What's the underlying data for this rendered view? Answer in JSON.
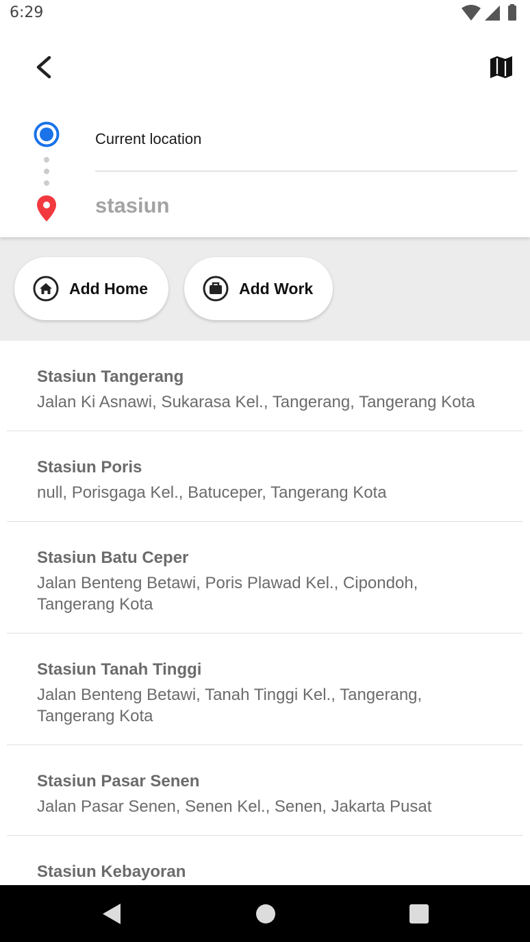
{
  "status_bar": {
    "time": "6:29"
  },
  "colors": {
    "accent_blue": "#1a73e8",
    "pin_red": "#f2393f",
    "shortcut_bg": "#ececec",
    "muted_text": "#6b6b6b"
  },
  "toolbar": {
    "back_icon": "chevron-left-icon",
    "map_icon": "map-icon"
  },
  "route": {
    "origin": "Current location",
    "destination": "stasiun"
  },
  "shortcuts": {
    "home_label": "Add Home",
    "work_label": "Add Work"
  },
  "results": [
    {
      "title": "Stasiun Tangerang",
      "address": "Jalan Ki Asnawi, Sukarasa Kel., Tangerang, Tangerang Kota"
    },
    {
      "title": "Stasiun Poris",
      "address": "null, Porisgaga Kel., Batuceper, Tangerang Kota"
    },
    {
      "title": "Stasiun Batu Ceper",
      "address": "Jalan Benteng Betawi, Poris Plawad Kel., Cipondoh, Tangerang Kota"
    },
    {
      "title": "Stasiun Tanah Tinggi",
      "address": "Jalan Benteng Betawi, Tanah Tinggi Kel., Tangerang, Tangerang Kota"
    },
    {
      "title": "Stasiun Pasar Senen",
      "address": "Jalan Pasar Senen, Senen Kel., Senen, Jakarta Pusat"
    },
    {
      "title": "Stasiun Kebayoran",
      "address": ""
    }
  ]
}
